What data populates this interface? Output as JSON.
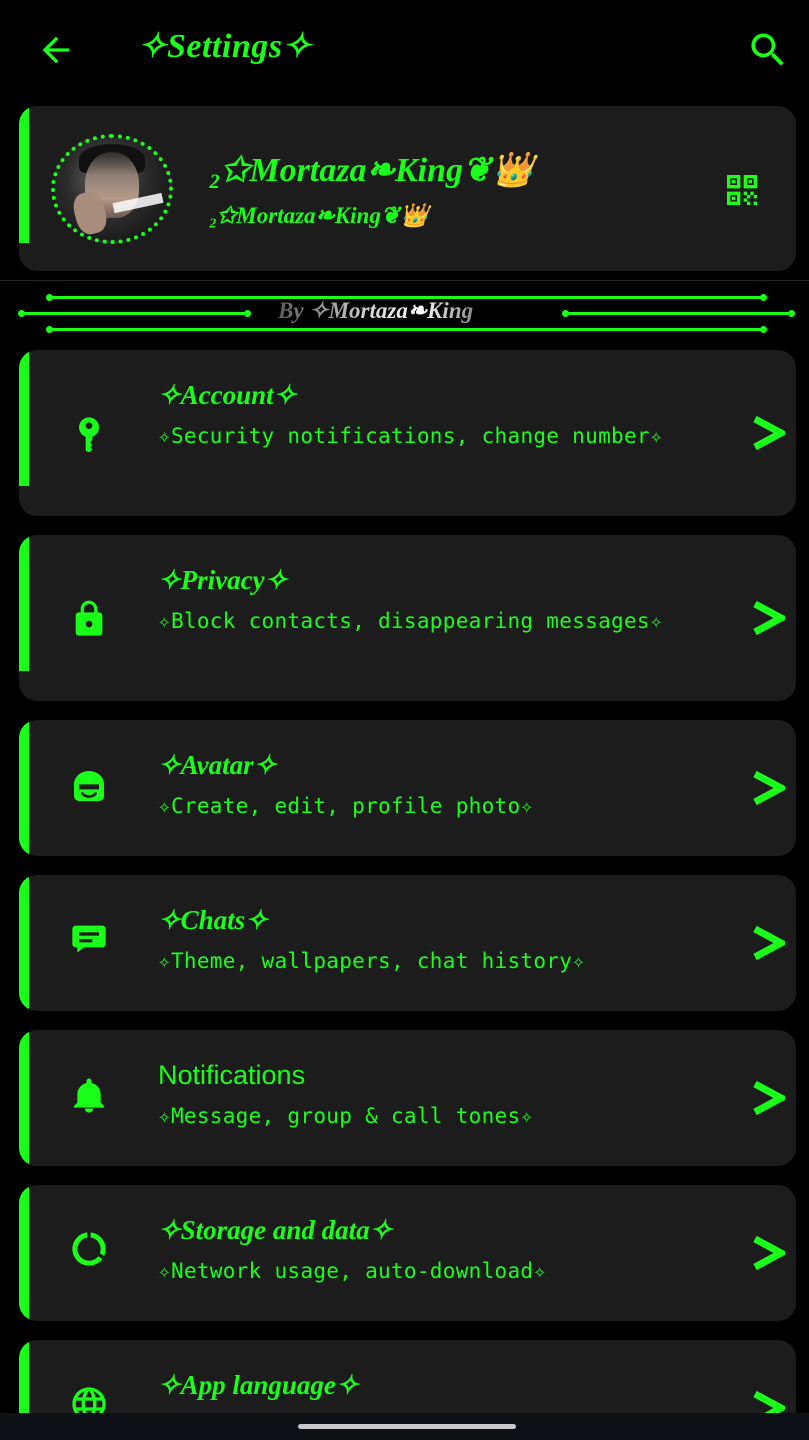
{
  "app_bar": {
    "title": "✧Settings✧",
    "back_icon": "arrow-left-icon",
    "search_icon": "search-icon"
  },
  "profile": {
    "name": "₂✩Mortaza❧King❦👑",
    "about": "₂✩Mortaza❧King❦👑",
    "qr_icon": "qr-code-icon"
  },
  "banner": {
    "text": "By ✧Mortaza❧King"
  },
  "settings": [
    {
      "title": "✧Account✧",
      "subtitle": "✧Security notifications, change number✧",
      "icon": "key-icon"
    },
    {
      "title": "✧Privacy✧",
      "subtitle": "✧Block contacts, disappearing messages✧",
      "icon": "lock-icon"
    },
    {
      "title": "✧Avatar✧",
      "subtitle": "✧Create, edit, profile photo✧",
      "icon": "avatar-icon"
    },
    {
      "title": "✧Chats✧",
      "subtitle": "✧Theme, wallpapers, chat history✧",
      "icon": "chat-icon"
    },
    {
      "title": "Notifications",
      "subtitle": "✧Message, group & call tones✧",
      "icon": "bell-icon"
    },
    {
      "title": "✧Storage and data✧",
      "subtitle": "✧Network usage, auto-download✧",
      "icon": "storage-icon"
    },
    {
      "title": "✧App language✧",
      "subtitle": "",
      "icon": "globe-icon"
    }
  ],
  "colors": {
    "accent": "#1aff1a",
    "background": "#000000",
    "card": "#1c1c1c"
  }
}
